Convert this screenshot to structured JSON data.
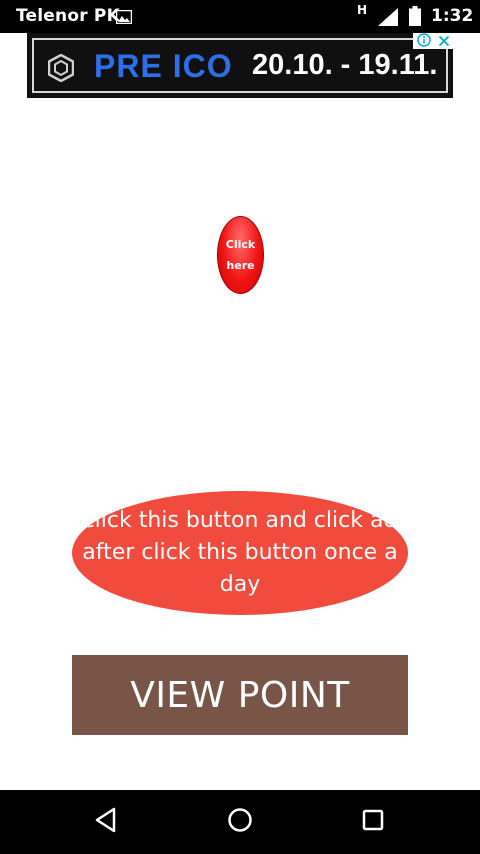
{
  "status_bar": {
    "carrier": "Telenor PK",
    "network_type": "H",
    "time": "1:32",
    "icons": [
      "gallery-icon",
      "signal-icon",
      "battery-icon"
    ]
  },
  "ad_banner": {
    "brand": "PRE ICO",
    "dates": "20.10. - 19.11.",
    "brand_color": "#2c6fe8",
    "icons": [
      "ico-logo-icon",
      "ad-info-icon",
      "ad-close-icon"
    ]
  },
  "main": {
    "click_here_label": "Click here",
    "daily_button_label": "click this button and click ad after click this button once a day",
    "view_point_label": "VIEW POINT"
  },
  "colors": {
    "daily_button": "#f04b3c",
    "view_point_button": "#795548",
    "click_here": "#f01515"
  },
  "nav_bar": {
    "icons": [
      "back-icon",
      "home-icon",
      "recents-icon"
    ]
  }
}
